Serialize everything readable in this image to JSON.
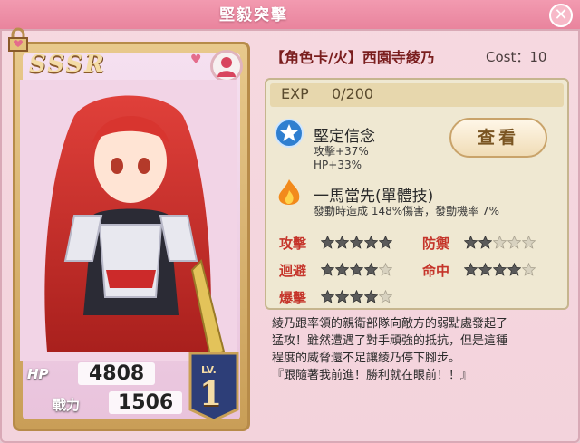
{
  "window": {
    "title": "堅毅突擊"
  },
  "card": {
    "rank": "SSSR",
    "hp_label": "HP",
    "hp": "4808",
    "power_label": "戰力",
    "power": "1506",
    "level_label": "LV.",
    "level": "1"
  },
  "info": {
    "name": "【角色卡/火】西園寺綾乃",
    "cost": "Cost：10",
    "exp_label": "EXP",
    "exp_value": "0/200"
  },
  "skills": [
    {
      "icon": "star-badge-icon",
      "name": "堅定信念",
      "desc1": "攻擊+37%",
      "desc2": "HP+33%"
    },
    {
      "icon": "flame-icon",
      "name": "一馬當先(單體技)",
      "desc1": "發動時造成 148%傷害，發動機率 7%"
    }
  ],
  "view_button": "查看",
  "stats": [
    {
      "label": "攻擊",
      "rating": 5
    },
    {
      "label": "防禦",
      "rating": 2
    },
    {
      "label": "迴避",
      "rating": 4
    },
    {
      "label": "命中",
      "rating": 4
    },
    {
      "label": "爆擊",
      "rating": 4
    }
  ],
  "description": {
    "line1": "綾乃跟率領的親衛部隊向敵方的弱點處發起了",
    "line2": "猛攻！雖然遭遇了對手頑強的抵抗，但是這種",
    "line3": "程度的威脅還不足讓綾乃停下腳步。",
    "line4": "『跟隨著我前進！勝利就在眼前！！』"
  }
}
